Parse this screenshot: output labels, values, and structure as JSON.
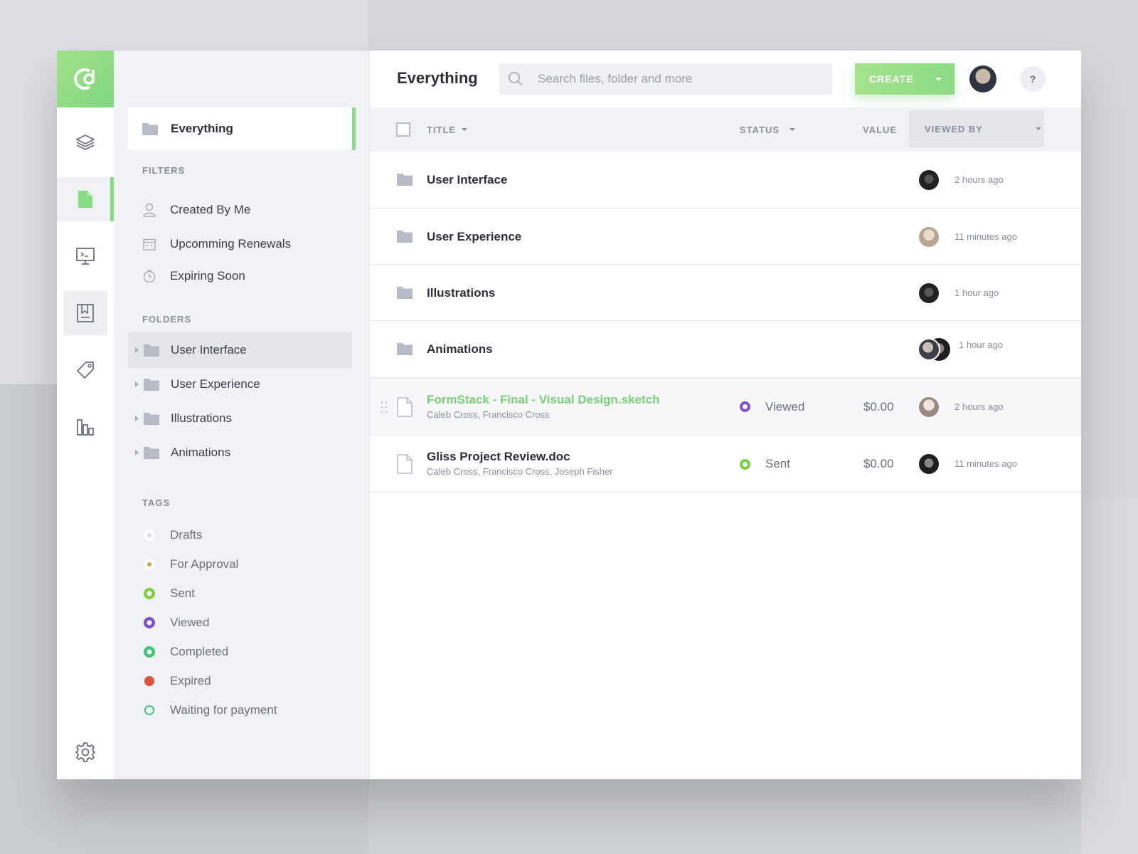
{
  "brand": {
    "accent": "#87dd84",
    "accent_light": "#a6e38d"
  },
  "rail": {
    "icons": [
      "layers-icon",
      "document-icon",
      "presentation-icon",
      "bookmark-icon",
      "tag-icon",
      "bar-chart-icon",
      "settings-icon"
    ]
  },
  "sidebar": {
    "everything_label": "Everything",
    "filters_title": "FILTERS",
    "filters": [
      {
        "label": "Created By Me",
        "icon": "user-icon"
      },
      {
        "label": "Upcomming Renewals",
        "icon": "calendar-icon"
      },
      {
        "label": "Expiring Soon",
        "icon": "stopwatch-icon"
      }
    ],
    "folders_title": "FOLDERS",
    "folders": [
      {
        "label": "User Interface"
      },
      {
        "label": "User Experience"
      },
      {
        "label": "Illustrations"
      },
      {
        "label": "Animations"
      }
    ],
    "tags_title": "TAGS",
    "tags": [
      {
        "label": "Drafts",
        "color": "#d8dbe0"
      },
      {
        "label": "For Approval",
        "color": "#c9a640"
      },
      {
        "label": "Sent",
        "color": "#7ccf3c"
      },
      {
        "label": "Viewed",
        "color": "#7d4fd1"
      },
      {
        "label": "Completed",
        "color": "#3ec77a"
      },
      {
        "label": "Expired",
        "color": "#d9543a"
      },
      {
        "label": "Waiting for payment",
        "color": "#3ec77a"
      }
    ]
  },
  "header": {
    "title": "Everything",
    "search_placeholder": "Search files, folder and more",
    "create_label": "CREATE",
    "help_label": "?"
  },
  "table": {
    "columns": {
      "title": "TITLE",
      "status": "STATUS",
      "value": "VALUE",
      "viewed_by": "VIEWED BY"
    },
    "rows": [
      {
        "type": "folder",
        "name": "User Interface",
        "time": "2 hours ago"
      },
      {
        "type": "folder",
        "name": "User Experience",
        "time": "11 minutes ago"
      },
      {
        "type": "folder",
        "name": "Illustrations",
        "time": "1 hour ago"
      },
      {
        "type": "folder",
        "name": "Animations",
        "time": "1 hour ago"
      },
      {
        "type": "file",
        "name": "FormStack - Final - Visual Design.sketch",
        "people": "Caleb Cross,  Francisco Cross",
        "status": "Viewed",
        "status_color": "#7d4fd1",
        "value": "$0.00",
        "time": "2 hours ago"
      },
      {
        "type": "file",
        "name": "Gliss Project Review.doc",
        "people": "Caleb Cross,  Francisco Cross, Joseph Fisher",
        "status": "Sent",
        "status_color": "#7ccf3c",
        "value": "$0.00",
        "time": "11 minutes ago"
      }
    ]
  }
}
